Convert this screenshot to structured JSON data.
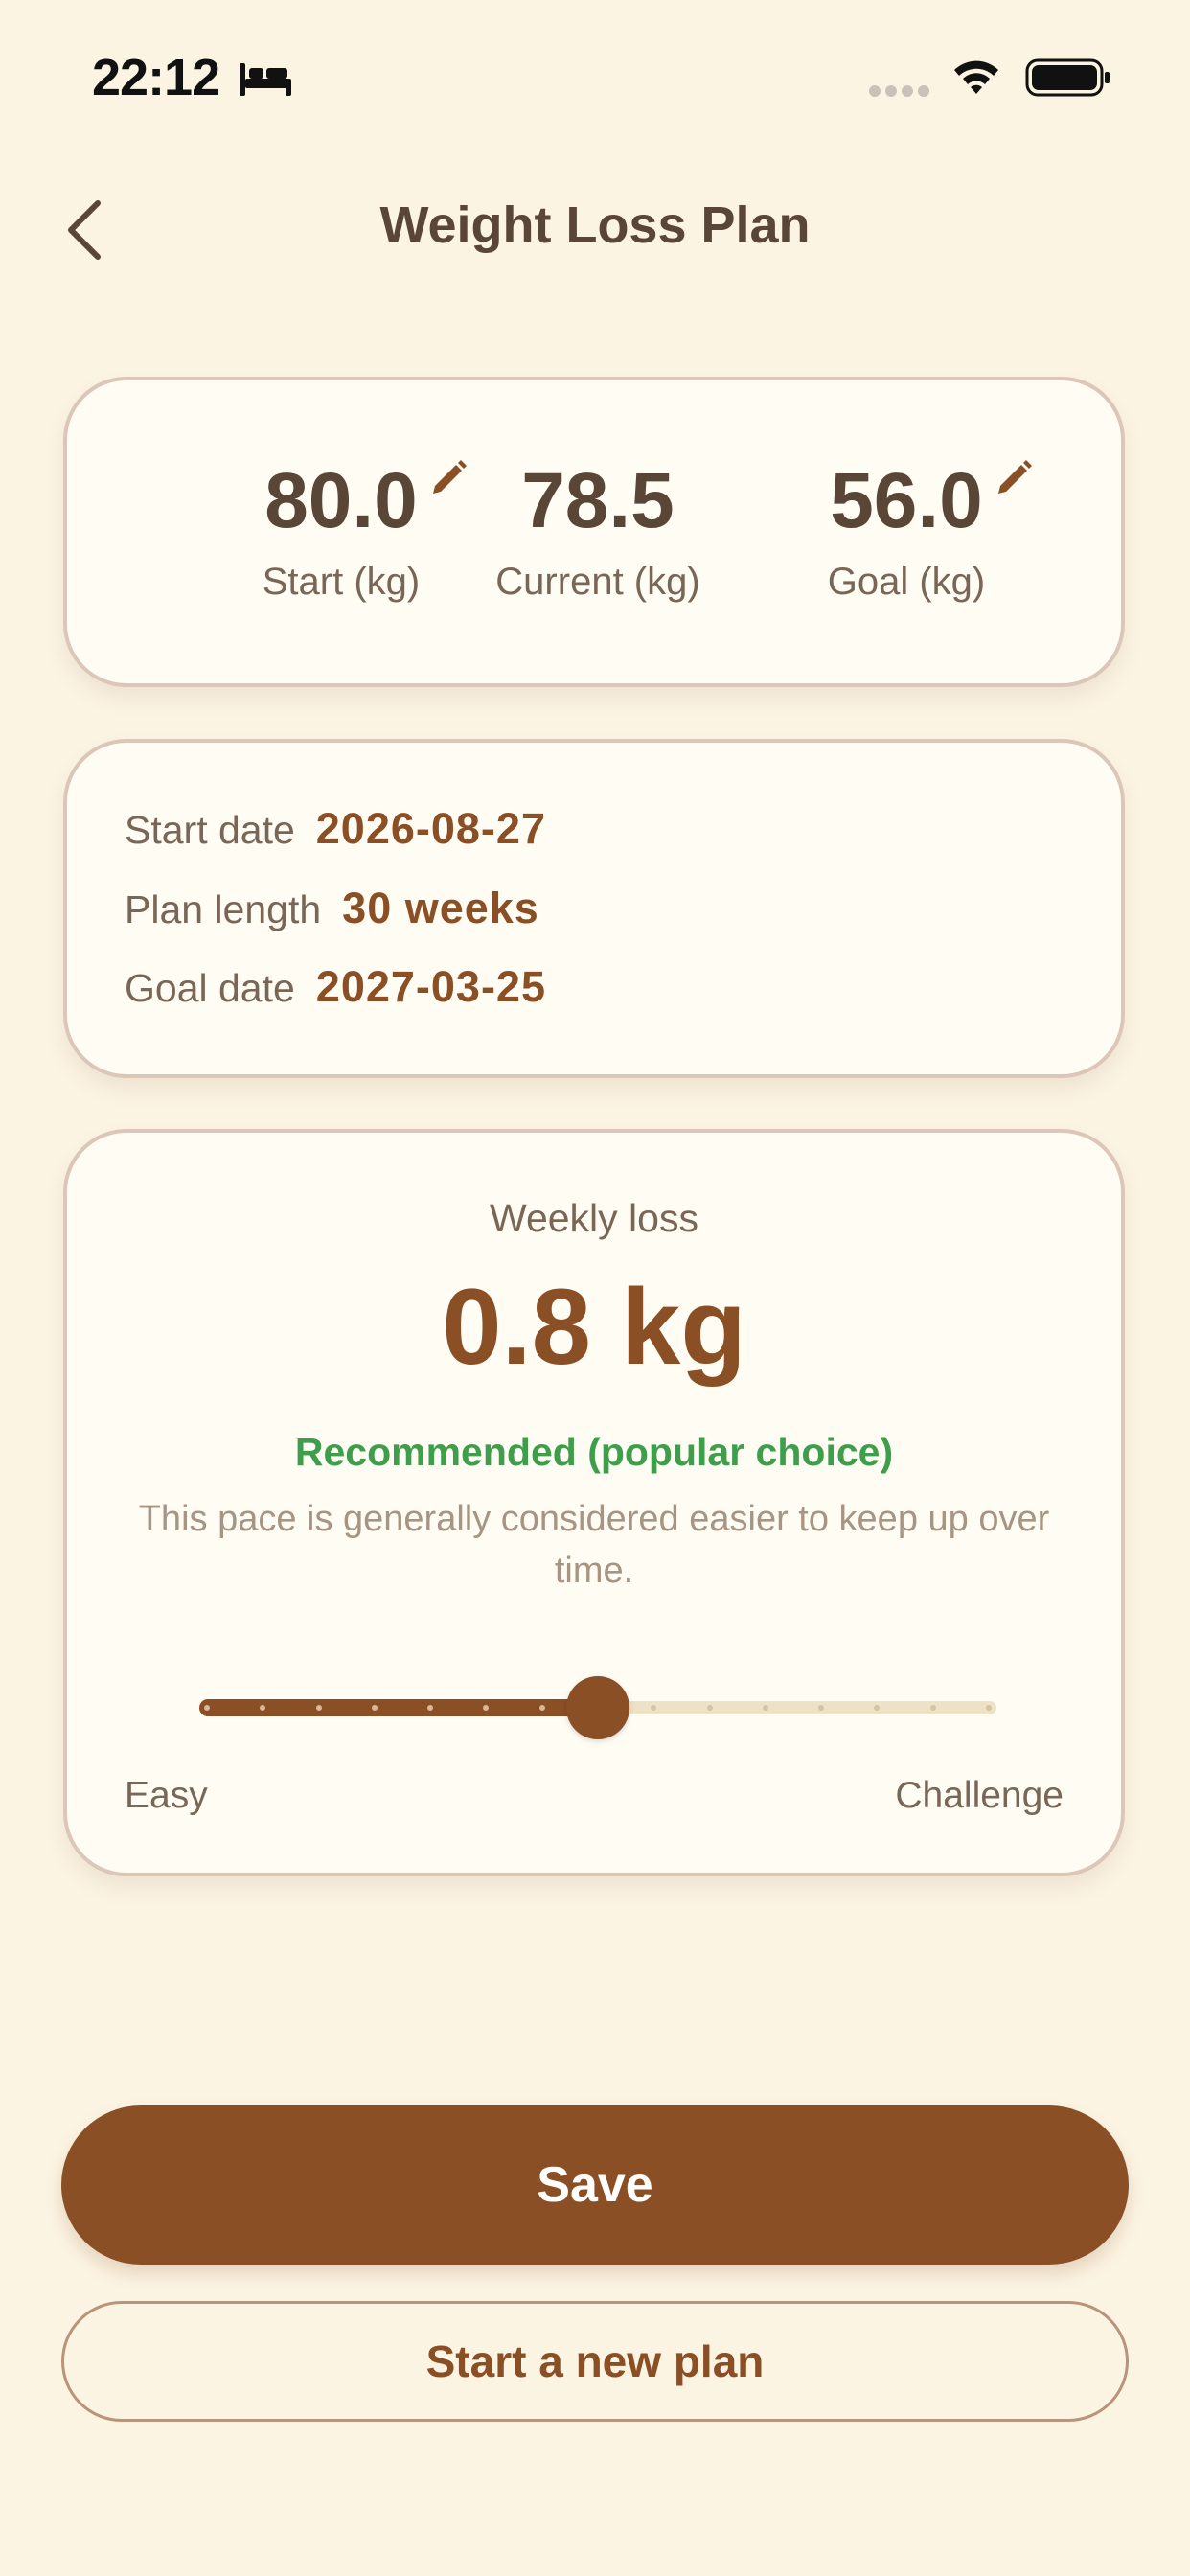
{
  "status_bar": {
    "time": "22:12",
    "icons": [
      "bed-icon",
      "cellular-signal-icon",
      "wifi-icon",
      "battery-icon"
    ]
  },
  "header": {
    "back_icon": "chevron-left-icon",
    "title": "Weight Loss Plan"
  },
  "weights": {
    "start": {
      "value": "80.0",
      "label": "Start (kg)",
      "editable": true
    },
    "current": {
      "value": "78.5",
      "label": "Current (kg)",
      "editable": false
    },
    "goal": {
      "value": "56.0",
      "label": "Goal (kg)",
      "editable": true
    }
  },
  "plan": {
    "start_date_label": "Start date",
    "start_date": "2026-08-27",
    "length_label": "Plan length",
    "length": "30 weeks",
    "goal_date_label": "Goal date",
    "goal_date": "2027-03-25"
  },
  "pace": {
    "title": "Weekly loss",
    "value": "0.8 kg",
    "recommendation": "Recommended (popular choice)",
    "description": "This pace is generally considered easier to keep up over time.",
    "slider": {
      "steps": 15,
      "selected_index": 7,
      "min_label": "Easy",
      "max_label": "Challenge"
    }
  },
  "actions": {
    "save_label": "Save",
    "new_plan_label": "Start a new plan"
  },
  "colors": {
    "background": "#fcf4e3",
    "card": "#fffcf4",
    "accent_brown": "#8b4f25",
    "text_dark": "#5a4636",
    "recommendation_green": "#3e9e4b",
    "track_inactive": "#ede2c6"
  }
}
